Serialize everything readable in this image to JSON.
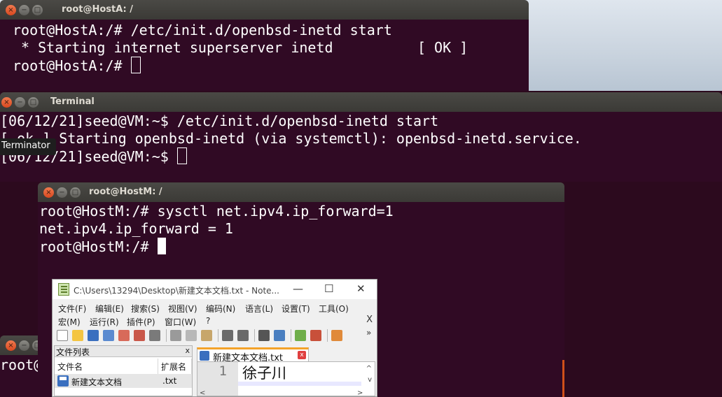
{
  "hostA": {
    "title": "root@HostA: /",
    "lines": [
      "root@HostA:/# /etc/init.d/openbsd-inetd start",
      " * Starting internet superserver inetd          [ OK ]",
      "root@HostA:/# "
    ]
  },
  "vm": {
    "title": "Terminal",
    "lines": [
      "[06/12/21]seed@VM:~$ /etc/init.d/openbsd-inetd start",
      "[ ok ] Starting openbsd-inetd (via systemctl): openbsd-inetd.service.",
      "[06/12/21]seed@VM:~$ "
    ],
    "tooltip": "Terminator"
  },
  "hostM": {
    "title": "root@HostM: /",
    "lines": [
      "root@HostM:/# sysctl net.ipv4.ip_forward=1",
      "net.ipv4.ip_forward = 1",
      "root@HostM:/# "
    ]
  },
  "bottom_term": {
    "line": "root@S"
  },
  "window_buttons": {
    "close": "×",
    "minimize": "−",
    "maximize": "□"
  },
  "notepad": {
    "title": "C:\\Users\\13294\\Desktop\\新建文本文档.txt - Note...",
    "controls": {
      "minimize": "—",
      "maximize": "☐",
      "close": "✕"
    },
    "menu_row1": [
      "文件(F)",
      "编辑(E)",
      "搜索(S)",
      "视图(V)",
      "编码(N)",
      "语言(L)",
      "设置(T)",
      "工具(O)"
    ],
    "menu_row2": [
      "宏(M)",
      "运行(R)",
      "插件(P)",
      "窗口(W)",
      "?"
    ],
    "menu_close": "X",
    "toolbar_more": "»",
    "panel": {
      "title": "文件列表",
      "close": "x",
      "col_name": "文件名",
      "col_ext": "扩展名",
      "file_name": "新建文本文档",
      "file_ext": ".txt"
    },
    "tab": {
      "label": "新建文本文档.txt",
      "close": "x"
    },
    "editor": {
      "line_number": "1",
      "content": "徐子川"
    },
    "scroll": {
      "up": "^",
      "down": "v",
      "left": "<",
      "right": ">"
    }
  },
  "colors": {
    "terminal_bg": "#300a24",
    "titlebar": "#3c3b37",
    "close_button": "#e65b2f",
    "tab_accent": "#f3a229"
  },
  "icons": [
    "close-icon",
    "minimize-icon",
    "maximize-icon",
    "notepad-app-icon",
    "file-icon",
    "new-file-icon",
    "open-icon",
    "save-icon",
    "save-all-icon",
    "close-file-icon",
    "close-all-icon",
    "print-icon",
    "cut-icon",
    "copy-icon",
    "paste-icon",
    "undo-icon",
    "redo-icon",
    "find-icon",
    "replace-icon",
    "zoom-in-icon",
    "zoom-out-icon",
    "sync-scroll-icon"
  ]
}
